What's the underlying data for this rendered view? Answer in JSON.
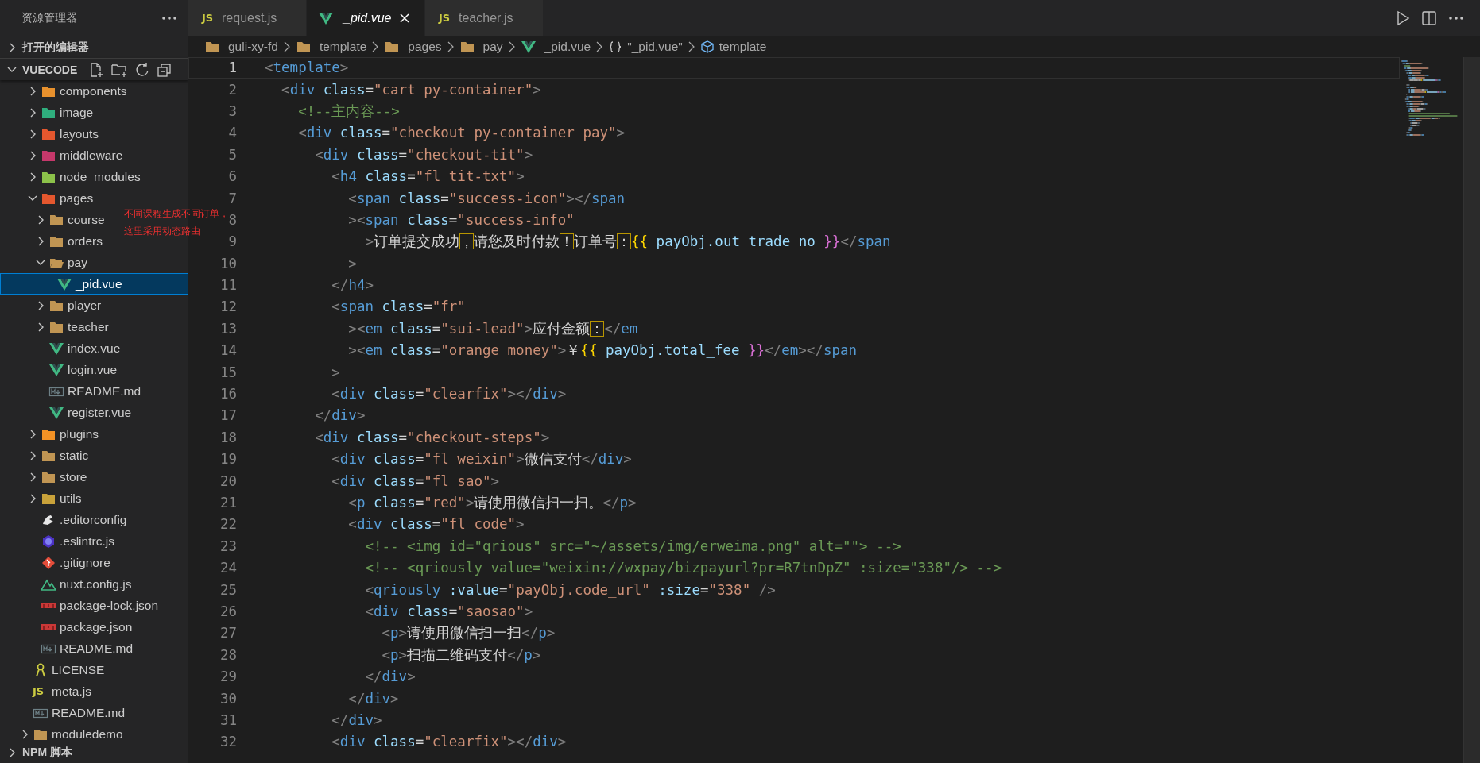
{
  "sidebar": {
    "title": "资源管理器",
    "sections": [
      {
        "label": "打开的编辑器",
        "expanded": false
      },
      {
        "label": "VUECODE",
        "expanded": true,
        "tree": [
          {
            "children": [
              {
                "label": "components",
                "kind": "folder",
                "color": "#e8912d",
                "expanded": false,
                "selected": false
              },
              {
                "label": "image",
                "kind": "folder",
                "color": "#2fae7d",
                "expanded": false,
                "selected": false
              },
              {
                "label": "layouts",
                "kind": "folder",
                "color": "#e4572e",
                "expanded": false,
                "selected": false
              },
              {
                "label": "middleware",
                "kind": "folder",
                "color": "#c6386b",
                "expanded": false,
                "selected": false
              },
              {
                "label": "node_modules",
                "kind": "folder",
                "color": "#8cc24a",
                "expanded": false,
                "selected": false
              },
              {
                "label": "pages",
                "kind": "folder",
                "color": "#e4572e",
                "expanded": true,
                "selected": false,
                "children": [
                  {
                    "label": "course",
                    "kind": "folder",
                    "expanded": false,
                    "selected": false
                  },
                  {
                    "label": "orders",
                    "kind": "folder",
                    "expanded": false,
                    "selected": false
                  },
                  {
                    "label": "pay",
                    "kind": "folder",
                    "expanded": true,
                    "selected": false,
                    "children": [
                      {
                        "label": "_pid.vue",
                        "kind": "vue",
                        "selected": true
                      }
                    ]
                  },
                  {
                    "label": "player",
                    "kind": "folder",
                    "expanded": false,
                    "selected": false
                  },
                  {
                    "label": "teacher",
                    "kind": "folder",
                    "expanded": false,
                    "selected": false
                  },
                  {
                    "label": "index.vue",
                    "kind": "vue",
                    "selected": false
                  },
                  {
                    "label": "login.vue",
                    "kind": "vue",
                    "selected": false
                  },
                  {
                    "label": "README.md",
                    "kind": "md",
                    "selected": false
                  },
                  {
                    "label": "register.vue",
                    "kind": "vue",
                    "selected": false
                  }
                ]
              },
              {
                "label": "plugins",
                "kind": "folder",
                "color": "#f39225",
                "expanded": false,
                "selected": false
              },
              {
                "label": "static",
                "kind": "folder",
                "expanded": false,
                "selected": false
              },
              {
                "label": "store",
                "kind": "folder",
                "expanded": false,
                "selected": false
              },
              {
                "label": "utils",
                "kind": "folder",
                "color": "#c9a23a",
                "expanded": false,
                "selected": false
              },
              {
                "label": ".editorconfig",
                "kind": "editorconfig",
                "selected": false
              },
              {
                "label": ".eslintrc.js",
                "kind": "eslint",
                "selected": false
              },
              {
                "label": ".gitignore",
                "kind": "git",
                "selected": false
              },
              {
                "label": "nuxt.config.js",
                "kind": "nuxt",
                "selected": false
              },
              {
                "label": "package-lock.json",
                "kind": "npm",
                "selected": false
              },
              {
                "label": "package.json",
                "kind": "npm",
                "selected": false
              },
              {
                "label": "README.md",
                "kind": "md",
                "selected": false
              }
            ]
          },
          {
            "label": "LICENSE",
            "kind": "license",
            "selected": false
          },
          {
            "label": "meta.js",
            "kind": "js",
            "glyph": "JS",
            "selected": false
          },
          {
            "label": "README.md",
            "kind": "md",
            "selected": false
          },
          {
            "label": "moduledemo",
            "kind": "folder",
            "expanded": false,
            "selected": false
          }
        ]
      },
      {
        "label": "NPM 脚本",
        "expanded": false
      }
    ]
  },
  "tabs": [
    {
      "label": "request.js",
      "kind": "js",
      "glyph": "JS",
      "selected": false,
      "preview": false
    },
    {
      "label": "_pid.vue",
      "kind": "vue",
      "selected": true,
      "preview": true
    },
    {
      "label": "teacher.js",
      "kind": "js",
      "glyph": "JS",
      "selected": false,
      "preview": false
    }
  ],
  "breadcrumb": [
    {
      "label": "guli-xy-fd",
      "kind": "folder"
    },
    {
      "label": "template",
      "kind": "folder"
    },
    {
      "label": "pages",
      "kind": "folder"
    },
    {
      "label": "pay",
      "kind": "folder"
    },
    {
      "label": "_pid.vue",
      "kind": "vue"
    },
    {
      "label": "\"_pid.vue\"",
      "kind": "object"
    },
    {
      "label": "template",
      "kind": "element"
    }
  ],
  "annotation": {
    "lines": [
      "不同课程生成不同订单，",
      "这里采用动态路由"
    ]
  },
  "lines": [
    {
      "number": "1",
      "current": true,
      "tokens": [
        {
          "kind": "p",
          "text": "<"
        },
        {
          "kind": "tag",
          "text": "template"
        },
        {
          "kind": "p",
          "text": ">"
        }
      ]
    },
    {
      "number": "2",
      "current": false,
      "tokens": [
        {
          "kind": "p",
          "text": "  <"
        },
        {
          "kind": "tag",
          "text": "div"
        },
        {
          "kind": "attr",
          "text": " class"
        },
        {
          "kind": "text",
          "text": "="
        },
        {
          "kind": "str",
          "text": "\"cart py-container\""
        },
        {
          "kind": "p",
          "text": ">"
        }
      ]
    },
    {
      "number": "3",
      "current": false,
      "tokens": [
        {
          "kind": "comment",
          "text": "    <!--主内容-->"
        }
      ]
    },
    {
      "number": "4",
      "current": false,
      "tokens": [
        {
          "kind": "p",
          "text": "    <"
        },
        {
          "kind": "tag",
          "text": "div"
        },
        {
          "kind": "attr",
          "text": " class"
        },
        {
          "kind": "text",
          "text": "="
        },
        {
          "kind": "str",
          "text": "\"checkout py-container pay\""
        },
        {
          "kind": "p",
          "text": ">"
        }
      ]
    },
    {
      "number": "5",
      "current": false,
      "tokens": [
        {
          "kind": "p",
          "text": "      <"
        },
        {
          "kind": "tag",
          "text": "div"
        },
        {
          "kind": "attr",
          "text": " class"
        },
        {
          "kind": "text",
          "text": "="
        },
        {
          "kind": "str",
          "text": "\"checkout-tit\""
        },
        {
          "kind": "p",
          "text": ">"
        }
      ]
    },
    {
      "number": "6",
      "current": false,
      "tokens": [
        {
          "kind": "p",
          "text": "        <"
        },
        {
          "kind": "tag",
          "text": "h4"
        },
        {
          "kind": "attr",
          "text": " class"
        },
        {
          "kind": "text",
          "text": "="
        },
        {
          "kind": "str",
          "text": "\"fl tit-txt\""
        },
        {
          "kind": "p",
          "text": ">"
        }
      ]
    },
    {
      "number": "7",
      "current": false,
      "tokens": [
        {
          "kind": "p",
          "text": "          <"
        },
        {
          "kind": "tag",
          "text": "span"
        },
        {
          "kind": "attr",
          "text": " class"
        },
        {
          "kind": "text",
          "text": "="
        },
        {
          "kind": "str",
          "text": "\"success-icon\""
        },
        {
          "kind": "p",
          "text": "></"
        },
        {
          "kind": "tag",
          "text": "span"
        }
      ]
    },
    {
      "number": "8",
      "current": false,
      "tokens": [
        {
          "kind": "p",
          "text": "          ><"
        },
        {
          "kind": "tag",
          "text": "span"
        },
        {
          "kind": "attr",
          "text": " class"
        },
        {
          "kind": "text",
          "text": "="
        },
        {
          "kind": "str",
          "text": "\"success-info\""
        }
      ]
    },
    {
      "number": "9",
      "current": false,
      "tokens": [
        {
          "kind": "p",
          "text": "            >"
        },
        {
          "kind": "text",
          "text": "订单提交成功"
        },
        {
          "kind": "boxed",
          "text": "，"
        },
        {
          "kind": "text",
          "text": "请您及时付款"
        },
        {
          "kind": "boxed",
          "text": "！"
        },
        {
          "kind": "text",
          "text": "订单号"
        },
        {
          "kind": "boxed",
          "text": "："
        },
        {
          "kind": "brace-open",
          "text": "{{"
        },
        {
          "kind": "attr",
          "text": " payObj.out_trade_no "
        },
        {
          "kind": "brace-close",
          "text": "}}"
        },
        {
          "kind": "p",
          "text": "</"
        },
        {
          "kind": "tag",
          "text": "span"
        }
      ]
    },
    {
      "number": "10",
      "current": false,
      "tokens": [
        {
          "kind": "p",
          "text": "          >"
        }
      ]
    },
    {
      "number": "11",
      "current": false,
      "tokens": [
        {
          "kind": "p",
          "text": "        </"
        },
        {
          "kind": "tag",
          "text": "h4"
        },
        {
          "kind": "p",
          "text": ">"
        }
      ]
    },
    {
      "number": "12",
      "current": false,
      "tokens": [
        {
          "kind": "p",
          "text": "        <"
        },
        {
          "kind": "tag",
          "text": "span"
        },
        {
          "kind": "attr",
          "text": " class"
        },
        {
          "kind": "text",
          "text": "="
        },
        {
          "kind": "str",
          "text": "\"fr\""
        }
      ]
    },
    {
      "number": "13",
      "current": false,
      "tokens": [
        {
          "kind": "p",
          "text": "          ><"
        },
        {
          "kind": "tag",
          "text": "em"
        },
        {
          "kind": "attr",
          "text": " class"
        },
        {
          "kind": "text",
          "text": "="
        },
        {
          "kind": "str",
          "text": "\"sui-lead\""
        },
        {
          "kind": "p",
          "text": ">"
        },
        {
          "kind": "text",
          "text": "应付金额"
        },
        {
          "kind": "boxed",
          "text": "："
        },
        {
          "kind": "p",
          "text": "</"
        },
        {
          "kind": "tag",
          "text": "em"
        }
      ]
    },
    {
      "number": "14",
      "current": false,
      "tokens": [
        {
          "kind": "p",
          "text": "          ><"
        },
        {
          "kind": "tag",
          "text": "em"
        },
        {
          "kind": "attr",
          "text": " class"
        },
        {
          "kind": "text",
          "text": "="
        },
        {
          "kind": "str",
          "text": "\"orange money\""
        },
        {
          "kind": "p",
          "text": ">"
        },
        {
          "kind": "text",
          "text": "￥"
        },
        {
          "kind": "brace-open",
          "text": "{{"
        },
        {
          "kind": "attr",
          "text": " payObj.total_fee "
        },
        {
          "kind": "brace-close",
          "text": "}}"
        },
        {
          "kind": "p",
          "text": "</"
        },
        {
          "kind": "tag",
          "text": "em"
        },
        {
          "kind": "p",
          "text": "></"
        },
        {
          "kind": "tag",
          "text": "span"
        }
      ]
    },
    {
      "number": "15",
      "current": false,
      "tokens": [
        {
          "kind": "p",
          "text": "        >"
        }
      ]
    },
    {
      "number": "16",
      "current": false,
      "tokens": [
        {
          "kind": "p",
          "text": "        <"
        },
        {
          "kind": "tag",
          "text": "div"
        },
        {
          "kind": "attr",
          "text": " class"
        },
        {
          "kind": "text",
          "text": "="
        },
        {
          "kind": "str",
          "text": "\"clearfix\""
        },
        {
          "kind": "p",
          "text": "></"
        },
        {
          "kind": "tag",
          "text": "div"
        },
        {
          "kind": "p",
          "text": ">"
        }
      ]
    },
    {
      "number": "17",
      "current": false,
      "tokens": [
        {
          "kind": "p",
          "text": "      </"
        },
        {
          "kind": "tag",
          "text": "div"
        },
        {
          "kind": "p",
          "text": ">"
        }
      ]
    },
    {
      "number": "18",
      "current": false,
      "tokens": [
        {
          "kind": "p",
          "text": "      <"
        },
        {
          "kind": "tag",
          "text": "div"
        },
        {
          "kind": "attr",
          "text": " class"
        },
        {
          "kind": "text",
          "text": "="
        },
        {
          "kind": "str",
          "text": "\"checkout-steps\""
        },
        {
          "kind": "p",
          "text": ">"
        }
      ]
    },
    {
      "number": "19",
      "current": false,
      "tokens": [
        {
          "kind": "p",
          "text": "        <"
        },
        {
          "kind": "tag",
          "text": "div"
        },
        {
          "kind": "attr",
          "text": " class"
        },
        {
          "kind": "text",
          "text": "="
        },
        {
          "kind": "str",
          "text": "\"fl weixin\""
        },
        {
          "kind": "p",
          "text": ">"
        },
        {
          "kind": "text",
          "text": "微信支付"
        },
        {
          "kind": "p",
          "text": "</"
        },
        {
          "kind": "tag",
          "text": "div"
        },
        {
          "kind": "p",
          "text": ">"
        }
      ]
    },
    {
      "number": "20",
      "current": false,
      "tokens": [
        {
          "kind": "p",
          "text": "        <"
        },
        {
          "kind": "tag",
          "text": "div"
        },
        {
          "kind": "attr",
          "text": " class"
        },
        {
          "kind": "text",
          "text": "="
        },
        {
          "kind": "str",
          "text": "\"fl sao\""
        },
        {
          "kind": "p",
          "text": ">"
        }
      ]
    },
    {
      "number": "21",
      "current": false,
      "tokens": [
        {
          "kind": "p",
          "text": "          <"
        },
        {
          "kind": "tag",
          "text": "p"
        },
        {
          "kind": "attr",
          "text": " class"
        },
        {
          "kind": "text",
          "text": "="
        },
        {
          "kind": "str",
          "text": "\"red\""
        },
        {
          "kind": "p",
          "text": ">"
        },
        {
          "kind": "text",
          "text": "请使用微信扫一扫。"
        },
        {
          "kind": "p",
          "text": "</"
        },
        {
          "kind": "tag",
          "text": "p"
        },
        {
          "kind": "p",
          "text": ">"
        }
      ]
    },
    {
      "number": "22",
      "current": false,
      "tokens": [
        {
          "kind": "p",
          "text": "          <"
        },
        {
          "kind": "tag",
          "text": "div"
        },
        {
          "kind": "attr",
          "text": " class"
        },
        {
          "kind": "text",
          "text": "="
        },
        {
          "kind": "str",
          "text": "\"fl code\""
        },
        {
          "kind": "p",
          "text": ">"
        }
      ]
    },
    {
      "number": "23",
      "current": false,
      "tokens": [
        {
          "kind": "comment",
          "text": "            <!-- <img id=\"qrious\" src=\"~/assets/img/erweima.png\" alt=\"\"> -->"
        }
      ]
    },
    {
      "number": "24",
      "current": false,
      "tokens": [
        {
          "kind": "comment",
          "text": "            <!-- <qriously value=\"weixin://wxpay/bizpayurl?pr=R7tnDpZ\" :size=\"338\"/> -->"
        }
      ]
    },
    {
      "number": "25",
      "current": false,
      "tokens": [
        {
          "kind": "p",
          "text": "            <"
        },
        {
          "kind": "tag",
          "text": "qriously"
        },
        {
          "kind": "attr",
          "text": " :value"
        },
        {
          "kind": "text",
          "text": "="
        },
        {
          "kind": "str",
          "text": "\"payObj.code_url\""
        },
        {
          "kind": "attr",
          "text": " :size"
        },
        {
          "kind": "text",
          "text": "="
        },
        {
          "kind": "str",
          "text": "\"338\""
        },
        {
          "kind": "p",
          "text": " />"
        }
      ]
    },
    {
      "number": "26",
      "current": false,
      "tokens": [
        {
          "kind": "p",
          "text": "            <"
        },
        {
          "kind": "tag",
          "text": "div"
        },
        {
          "kind": "attr",
          "text": " class"
        },
        {
          "kind": "text",
          "text": "="
        },
        {
          "kind": "str",
          "text": "\"saosao\""
        },
        {
          "kind": "p",
          "text": ">"
        }
      ]
    },
    {
      "number": "27",
      "current": false,
      "tokens": [
        {
          "kind": "p",
          "text": "              <"
        },
        {
          "kind": "tag",
          "text": "p"
        },
        {
          "kind": "p",
          "text": ">"
        },
        {
          "kind": "text",
          "text": "请使用微信扫一扫"
        },
        {
          "kind": "p",
          "text": "</"
        },
        {
          "kind": "tag",
          "text": "p"
        },
        {
          "kind": "p",
          "text": ">"
        }
      ]
    },
    {
      "number": "28",
      "current": false,
      "tokens": [
        {
          "kind": "p",
          "text": "              <"
        },
        {
          "kind": "tag",
          "text": "p"
        },
        {
          "kind": "p",
          "text": ">"
        },
        {
          "kind": "text",
          "text": "扫描二维码支付"
        },
        {
          "kind": "p",
          "text": "</"
        },
        {
          "kind": "tag",
          "text": "p"
        },
        {
          "kind": "p",
          "text": ">"
        }
      ]
    },
    {
      "number": "29",
      "current": false,
      "tokens": [
        {
          "kind": "p",
          "text": "            </"
        },
        {
          "kind": "tag",
          "text": "div"
        },
        {
          "kind": "p",
          "text": ">"
        }
      ]
    },
    {
      "number": "30",
      "current": false,
      "tokens": [
        {
          "kind": "p",
          "text": "          </"
        },
        {
          "kind": "tag",
          "text": "div"
        },
        {
          "kind": "p",
          "text": ">"
        }
      ]
    },
    {
      "number": "31",
      "current": false,
      "tokens": [
        {
          "kind": "p",
          "text": "        </"
        },
        {
          "kind": "tag",
          "text": "div"
        },
        {
          "kind": "p",
          "text": ">"
        }
      ]
    },
    {
      "number": "32",
      "current": false,
      "tokens": [
        {
          "kind": "p",
          "text": "        <"
        },
        {
          "kind": "tag",
          "text": "div"
        },
        {
          "kind": "attr",
          "text": " class"
        },
        {
          "kind": "text",
          "text": "="
        },
        {
          "kind": "str",
          "text": "\"clearfix\""
        },
        {
          "kind": "p",
          "text": "></"
        },
        {
          "kind": "tag",
          "text": "div"
        },
        {
          "kind": "p",
          "text": ">"
        }
      ]
    }
  ]
}
